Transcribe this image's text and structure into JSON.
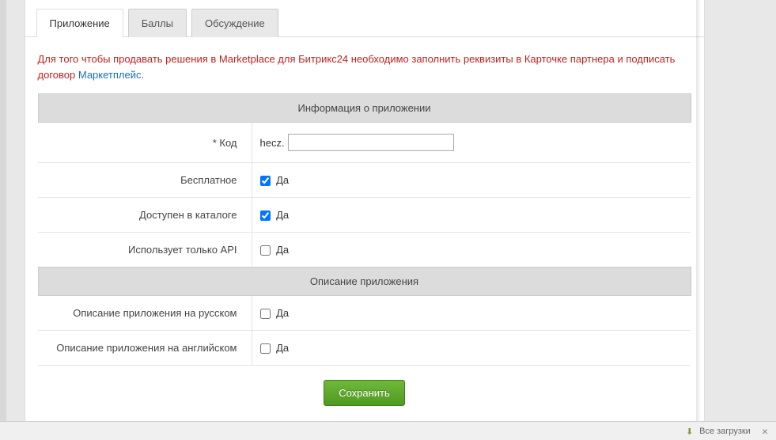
{
  "tabs": {
    "app": "Приложение",
    "points": "Баллы",
    "discussion": "Обсуждение"
  },
  "notice": {
    "text_before": "Для того чтобы продавать решения в Marketplace для Битрикс24 необходимо заполнить реквизиты в Карточке партнера и подписать договор ",
    "link_text": "Маркетплейс",
    "text_after": "."
  },
  "sections": {
    "app_info": "Информация о приложении",
    "app_desc": "Описание приложения"
  },
  "fields": {
    "code": {
      "label": "* Код",
      "prefix": "hecz.",
      "value": ""
    },
    "free": {
      "label": "Бесплатное",
      "option": "Да",
      "checked": true
    },
    "catalog": {
      "label": "Доступен в каталоге",
      "option": "Да",
      "checked": true
    },
    "api_only": {
      "label": "Использует только API",
      "option": "Да",
      "checked": false
    },
    "desc_ru": {
      "label": "Описание приложения на русском",
      "option": "Да",
      "checked": false
    },
    "desc_en": {
      "label": "Описание приложения на английском",
      "option": "Да",
      "checked": false
    }
  },
  "buttons": {
    "save": "Сохранить"
  },
  "bottom_bar": {
    "downloads": "Все загрузки"
  }
}
